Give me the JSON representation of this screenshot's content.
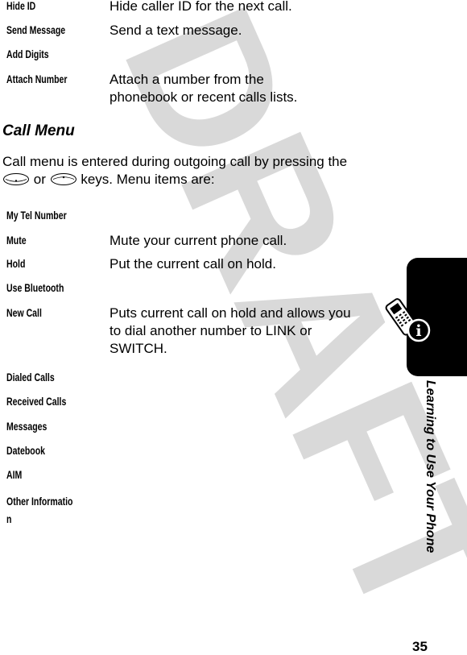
{
  "watermark": "DRAFT",
  "top_items": [
    {
      "term": "Hide ID",
      "description": "Hide caller ID for the next call."
    },
    {
      "term": "Send Message",
      "description": "Send a text message."
    },
    {
      "term": "Add Digits",
      "description": ""
    },
    {
      "term": "Attach Number",
      "description": "Attach a number from the phonebook or recent calls lists."
    }
  ],
  "section": {
    "title": "Call Menu",
    "intro_before": "Call menu is entered during outgoing call by pressing the",
    "key1_icon": "nav-down-key-icon",
    "intro_or": "or",
    "key2_icon": "nav-up-key-icon",
    "intro_after": "keys. Menu items are:"
  },
  "menu_items": [
    {
      "term": "My Tel Number",
      "description": ""
    },
    {
      "term": "Mute",
      "description": "Mute your current phone call."
    },
    {
      "term": "Hold",
      "description": "Put the current call on hold."
    },
    {
      "term": "Use Bluetooth",
      "description": ""
    },
    {
      "term": "New Call",
      "description": "Puts current call on hold and allows you to dial another number to LINK or SWITCH."
    },
    {
      "term": "Dialed Calls",
      "description": ""
    },
    {
      "term": "Received Calls",
      "description": ""
    },
    {
      "term": "Messages",
      "description": ""
    },
    {
      "term": "Datebook",
      "description": ""
    },
    {
      "term": "AIM",
      "description": ""
    },
    {
      "term": "Other Informatio\nn",
      "description": ""
    }
  ],
  "side_tab": {
    "icon": "phone-info-icon",
    "label": "Learning to Use Your Phone"
  },
  "page_number": "35"
}
